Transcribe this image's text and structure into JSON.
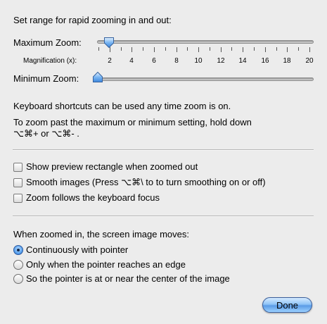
{
  "zoom_range": {
    "intro": "Set range for rapid zooming in and out:",
    "maximum_label": "Maximum Zoom:",
    "minimum_label": "Minimum Zoom:",
    "magnification_label": "Magnification (x):",
    "magnification_ticks": [
      "2",
      "4",
      "6",
      "8",
      "10",
      "12",
      "14",
      "16",
      "18",
      "20"
    ],
    "maximum_value": 2,
    "minimum_value": 1
  },
  "shortcuts": {
    "line1": "Keyboard shortcuts can be used any time zoom is on.",
    "line2": "To zoom past the maximum or minimum setting, hold down",
    "line3": "⌥⌘+ or ⌥⌘- ."
  },
  "options": [
    {
      "label": "Show preview rectangle when zoomed out",
      "checked": false
    },
    {
      "label": "Smooth images (Press ⌥⌘\\ to to turn smoothing on or off)",
      "checked": false
    },
    {
      "label": "Zoom follows the keyboard focus",
      "checked": false
    }
  ],
  "movement": {
    "heading": "When zoomed in, the screen image moves:",
    "choices": [
      {
        "label": "Continuously with pointer",
        "selected": true
      },
      {
        "label": "Only when the pointer reaches an edge",
        "selected": false
      },
      {
        "label": "So the pointer is at or near the center of the image",
        "selected": false
      }
    ]
  },
  "done_label": "Done",
  "colors": {
    "background": "#ececec",
    "accent": "#5a9be6"
  }
}
